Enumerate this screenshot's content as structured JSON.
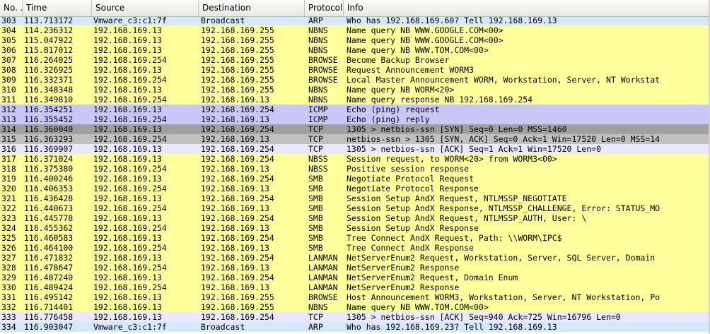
{
  "columns": [
    "No. .",
    "Time",
    "Source",
    "Destination",
    "Protocol",
    "Info"
  ],
  "colors": {
    "yellow": "#ffff9c",
    "purple": "#c8c8f8",
    "lavender": "#e8e8ff",
    "dark_gray": "#a0a0a0",
    "gray": "#c0c0c0",
    "arp_blue": "#d6e9f8"
  },
  "rows": [
    {
      "no": "303",
      "time": "113.713172",
      "src": "Vmware_c3:c1:7f",
      "dst": "Broadcast",
      "proto": "ARP",
      "info": "Who has 192.168.169.60?  Tell 192.168.169.13",
      "color": "arp_blue"
    },
    {
      "no": "304",
      "time": "114.236312",
      "src": "192.168.169.13",
      "dst": "192.168.169.255",
      "proto": "NBNS",
      "info": "Name query NB WWW.GOOGLE.COM<00>",
      "color": "yellow"
    },
    {
      "no": "305",
      "time": "115.047922",
      "src": "192.168.169.13",
      "dst": "192.168.169.255",
      "proto": "NBNS",
      "info": "Name query NB WWW.GOOGLE.COM<00>",
      "color": "yellow"
    },
    {
      "no": "306",
      "time": "115.817012",
      "src": "192.168.169.13",
      "dst": "192.168.169.255",
      "proto": "NBNS",
      "info": "Name query NB WWW.TOM.COM<00>",
      "color": "yellow"
    },
    {
      "no": "307",
      "time": "116.264025",
      "src": "192.168.169.254",
      "dst": "192.168.169.255",
      "proto": "BROWSE",
      "info": "Become Backup Browser",
      "color": "yellow"
    },
    {
      "no": "308",
      "time": "116.326925",
      "src": "192.168.169.13",
      "dst": "192.168.169.255",
      "proto": "BROWSE",
      "info": "Request Announcement WORM3",
      "color": "yellow"
    },
    {
      "no": "309",
      "time": "116.332371",
      "src": "192.168.169.254",
      "dst": "192.168.169.255",
      "proto": "BROWSE",
      "info": "Local Master Announcement WORM, Workstation, Server, NT Workstat",
      "color": "yellow"
    },
    {
      "no": "310",
      "time": "116.348348",
      "src": "192.168.169.13",
      "dst": "192.168.169.255",
      "proto": "NBNS",
      "info": "Name query NB WORM<20>",
      "color": "yellow"
    },
    {
      "no": "311",
      "time": "116.349810",
      "src": "192.168.169.254",
      "dst": "192.168.169.13",
      "proto": "NBNS",
      "info": "Name query response NB 192.168.169.254",
      "color": "yellow"
    },
    {
      "no": "312",
      "time": "116.354251",
      "src": "192.168.169.13",
      "dst": "192.168.169.254",
      "proto": "ICMP",
      "info": "Echo (ping) request",
      "color": "purple"
    },
    {
      "no": "313",
      "time": "116.355452",
      "src": "192.168.169.254",
      "dst": "192.168.169.13",
      "proto": "ICMP",
      "info": "Echo (ping) reply",
      "color": "purple"
    },
    {
      "no": "314",
      "time": "116.360040",
      "src": "192.168.169.13",
      "dst": "192.168.169.254",
      "proto": "TCP",
      "info": "1305 > netbios-ssn [SYN] Seq=0 Len=0 MSS=1460",
      "color": "dark_gray"
    },
    {
      "no": "315",
      "time": "116.363293",
      "src": "192.168.169.254",
      "dst": "192.168.169.13",
      "proto": "TCP",
      "info": "netbios-ssn > 1305 [SYN, ACK] Seq=0 Ack=1 Win=17520 Len=0 MSS=14",
      "color": "gray"
    },
    {
      "no": "316",
      "time": "116.369907",
      "src": "192.168.169.13",
      "dst": "192.168.169.254",
      "proto": "TCP",
      "info": "1305 > netbios-ssn [ACK] Seq=1 Ack=1 Win=17520 Len=0",
      "color": "lavender"
    },
    {
      "no": "317",
      "time": "116.371024",
      "src": "192.168.169.13",
      "dst": "192.168.169.254",
      "proto": "NBSS",
      "info": "Session request, to WORM<20> from WORM3<00>",
      "color": "yellow"
    },
    {
      "no": "318",
      "time": "116.375380",
      "src": "192.168.169.254",
      "dst": "192.168.169.13",
      "proto": "NBSS",
      "info": "Positive session response",
      "color": "yellow"
    },
    {
      "no": "319",
      "time": "116.400246",
      "src": "192.168.169.13",
      "dst": "192.168.169.254",
      "proto": "SMB",
      "info": "Negotiate Protocol Request",
      "color": "yellow"
    },
    {
      "no": "320",
      "time": "116.406353",
      "src": "192.168.169.254",
      "dst": "192.168.169.13",
      "proto": "SMB",
      "info": "Negotiate Protocol Response",
      "color": "yellow"
    },
    {
      "no": "321",
      "time": "116.436428",
      "src": "192.168.169.13",
      "dst": "192.168.169.254",
      "proto": "SMB",
      "info": "Session Setup AndX Request, NTLMSSP_NEGOTIATE",
      "color": "yellow"
    },
    {
      "no": "322",
      "time": "116.440673",
      "src": "192.168.169.254",
      "dst": "192.168.169.13",
      "proto": "SMB",
      "info": "Session Setup AndX Response, NTLMSSP_CHALLENGE, Error: STATUS_MO",
      "color": "yellow"
    },
    {
      "no": "323",
      "time": "116.445778",
      "src": "192.168.169.13",
      "dst": "192.168.169.254",
      "proto": "SMB",
      "info": "Session Setup AndX Request, NTLMSSP_AUTH, User: \\",
      "color": "yellow"
    },
    {
      "no": "324",
      "time": "116.455362",
      "src": "192.168.169.254",
      "dst": "192.168.169.13",
      "proto": "SMB",
      "info": "Session Setup AndX Response",
      "color": "yellow"
    },
    {
      "no": "325",
      "time": "116.460583",
      "src": "192.168.169.13",
      "dst": "192.168.169.254",
      "proto": "SMB",
      "info": "Tree Connect AndX Request, Path: \\\\WORM\\IPC$",
      "color": "yellow"
    },
    {
      "no": "326",
      "time": "116.464100",
      "src": "192.168.169.254",
      "dst": "192.168.169.13",
      "proto": "SMB",
      "info": "Tree Connect AndX Response",
      "color": "yellow"
    },
    {
      "no": "327",
      "time": "116.471832",
      "src": "192.168.169.13",
      "dst": "192.168.169.254",
      "proto": "LANMAN",
      "info": "NetServerEnum2 Request, Workstation, Server, SQL Server, Domain",
      "color": "yellow"
    },
    {
      "no": "328",
      "time": "116.478647",
      "src": "192.168.169.254",
      "dst": "192.168.169.13",
      "proto": "LANMAN",
      "info": "NetServerEnum2 Response",
      "color": "yellow"
    },
    {
      "no": "329",
      "time": "116.487240",
      "src": "192.168.169.13",
      "dst": "192.168.169.254",
      "proto": "LANMAN",
      "info": "NetServerEnum2 Request, Domain Enum",
      "color": "yellow"
    },
    {
      "no": "330",
      "time": "116.489424",
      "src": "192.168.169.254",
      "dst": "192.168.169.13",
      "proto": "LANMAN",
      "info": "NetServerEnum2 Response",
      "color": "yellow"
    },
    {
      "no": "331",
      "time": "116.495142",
      "src": "192.168.169.13",
      "dst": "192.168.169.255",
      "proto": "BROWSE",
      "info": "Host Announcement WORM3, Workstation, Server, NT Workstation, Po",
      "color": "yellow"
    },
    {
      "no": "332",
      "time": "116.714401",
      "src": "192.168.169.13",
      "dst": "192.168.169.255",
      "proto": "NBNS",
      "info": "Name query NB WWW.TOM.COM<00>",
      "color": "yellow"
    },
    {
      "no": "333",
      "time": "116.776458",
      "src": "192.168.169.13",
      "dst": "192.168.169.254",
      "proto": "TCP",
      "info": "1305 > netbios-ssn [ACK] Seq=940 Ack=725 Win=16796 Len=0",
      "color": "lavender"
    },
    {
      "no": "334",
      "time": "116.903047",
      "src": "Vmware_c3:c1:7f",
      "dst": "Broadcast",
      "proto": "ARP",
      "info": "Who has 192.168.169.23?  Tell 192.168.169.13",
      "color": "arp_blue"
    }
  ]
}
